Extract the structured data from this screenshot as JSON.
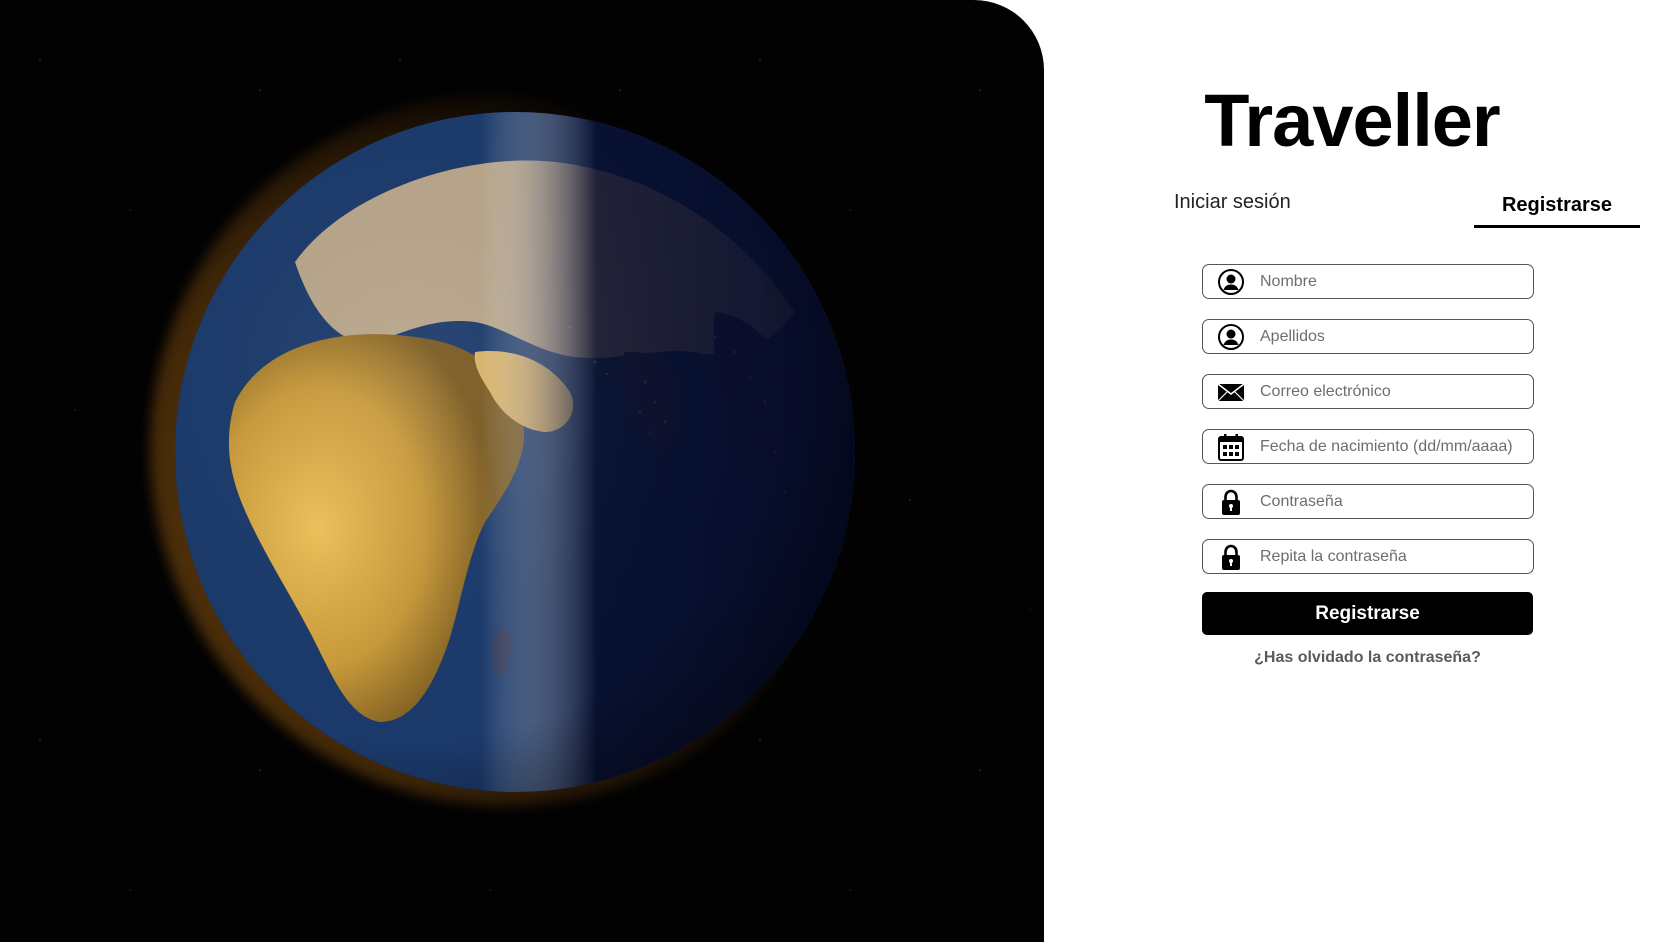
{
  "brand": {
    "title": "Traveller"
  },
  "tabs": [
    {
      "label": "Iniciar sesión",
      "active": false
    },
    {
      "label": "Registrarse",
      "active": true
    }
  ],
  "form": {
    "fields": [
      {
        "icon": "user-circle-icon",
        "placeholder": "Nombre",
        "value": ""
      },
      {
        "icon": "user-circle-icon",
        "placeholder": "Apellidos",
        "value": ""
      },
      {
        "icon": "envelope-icon",
        "placeholder": "Correo electrónico",
        "value": ""
      },
      {
        "icon": "calendar-icon",
        "placeholder": "Fecha de nacimiento (dd/mm/aaaa)",
        "value": ""
      },
      {
        "icon": "lock-icon",
        "placeholder": "Contraseña",
        "value": ""
      },
      {
        "icon": "lock-icon",
        "placeholder": "Repita la contraseña",
        "value": ""
      }
    ],
    "submit_label": "Registrarse",
    "forgot_label": "¿Has olvidado la contraseña?"
  },
  "colors": {
    "primary": "#000000",
    "background": "#ffffff",
    "space": "#020203",
    "earth_glow": "#ffaa28"
  }
}
